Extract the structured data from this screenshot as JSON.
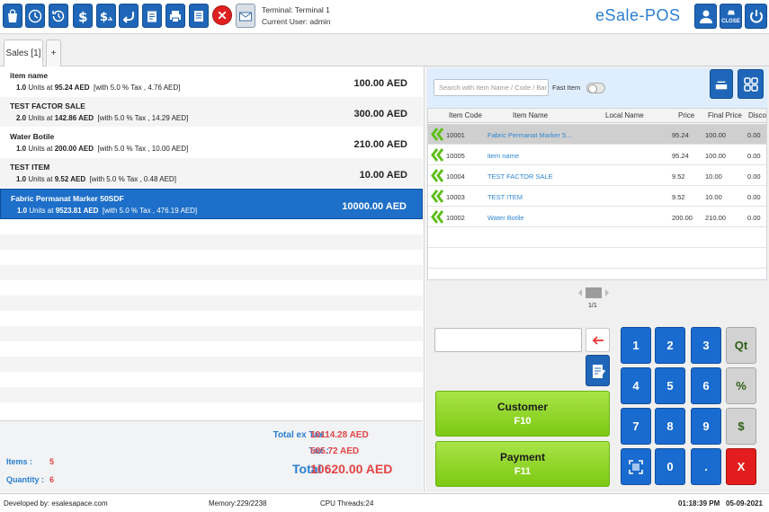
{
  "terminal": {
    "terminal_label": "Terminal: Terminal 1",
    "user_label": "Current User: admin"
  },
  "brand": "eSale-POS",
  "toolbar_icons": [
    "bag-icon",
    "clock-icon",
    "history-icon",
    "dollar-icon",
    "dollar-return-icon",
    "undo-icon",
    "clipboard-icon",
    "printer-icon",
    "report-icon",
    "cancel-icon",
    "mail-icon"
  ],
  "right_icons": {
    "user": "user-icon",
    "close_label": "CLOSE",
    "power": "power-icon"
  },
  "tabs": [
    {
      "label": "Sales [1]"
    },
    {
      "label": "+"
    }
  ],
  "cart": [
    {
      "name": "item name",
      "qty": "1.0",
      "units_at": "Units at",
      "price": "95.24 AED",
      "tax": "[with 5.0 % Tax , 4.76 AED]",
      "total": "100.00 AED"
    },
    {
      "name": "TEST FACTOR SALE",
      "qty": "2.0",
      "units_at": "Units at",
      "price": "142.86 AED",
      "tax": "[with 5.0 % Tax , 14.29 AED]",
      "total": "300.00 AED"
    },
    {
      "name": "Water Botile",
      "qty": "1.0",
      "units_at": "Units at",
      "price": "200.00 AED",
      "tax": "[with 5.0 % Tax , 10.00 AED]",
      "total": "210.00 AED"
    },
    {
      "name": "TEST ITEM",
      "qty": "1.0",
      "units_at": "Units at",
      "price": "9.52 AED",
      "tax": "[with 5.0 % Tax , 0.48 AED]",
      "total": "10.00 AED"
    },
    {
      "name": "Fabric Permanat Marker 50SDF",
      "qty": "1.0",
      "units_at": "Units at",
      "price": "9523.81 AED",
      "tax": "[with 5.0 % Tax , 476.19 AED]",
      "total": "10000.00 AED"
    }
  ],
  "summary": {
    "total_ex_tax_label": "Total ex Tax :",
    "total_ex_tax": "10114.28 AED",
    "tax_label": "Tax :",
    "tax": "505.72 AED",
    "total_label": "Total :",
    "total": "10620.00 AED",
    "items_label": "Items :",
    "items": "5",
    "quantity_label": "Quantity :",
    "quantity": "6"
  },
  "search": {
    "placeholder": "Search with Item Name / Code / Bar",
    "fast_item_label": "Fast Item"
  },
  "grid": {
    "columns": [
      "Item Code",
      "Item Name",
      "Local Name",
      "Price",
      "Final Price",
      "Disco"
    ],
    "rows": [
      {
        "code": "10001",
        "name": "Fabric Permanat Marker 5...",
        "local": "",
        "price": "95.24",
        "final": "100.00",
        "disc": "0.00"
      },
      {
        "code": "10005",
        "name": "item name",
        "local": "",
        "price": "95.24",
        "final": "100.00",
        "disc": "0.00"
      },
      {
        "code": "10004",
        "name": "TEST FACTOR SALE",
        "local": "",
        "price": "9.52",
        "final": "10.00",
        "disc": "0.00"
      },
      {
        "code": "10003",
        "name": "TEST ITEM",
        "local": "",
        "price": "9.52",
        "final": "10.00",
        "disc": "0.00"
      },
      {
        "code": "10002",
        "name": "Water Botile",
        "local": "",
        "price": "200.00",
        "final": "210.00",
        "disc": "0.00"
      }
    ]
  },
  "pager": {
    "page": "1/1"
  },
  "actions": {
    "customer_label": "Customer",
    "customer_key": "F10",
    "payment_label": "Payment",
    "payment_key": "F11"
  },
  "keypad": {
    "k1": "1",
    "k2": "2",
    "k3": "3",
    "qt": "Qt",
    "k4": "4",
    "k5": "5",
    "k6": "6",
    "pct": "%",
    "k7": "7",
    "k8": "8",
    "k9": "9",
    "dollar": "$",
    "k0": "0",
    "dot": ".",
    "clear": "X"
  },
  "status": {
    "developer": "Developed by: esalesapace.com",
    "memory": "Memory:229/2238",
    "threads": "CPU Threads:24",
    "time": "01:18:39 PM",
    "date": "05-09-2021"
  },
  "colors": {
    "accent": "#1f66b8",
    "brand_text": "#2a7fd0",
    "total_red": "#e24545",
    "selected_row": "#1d6fc9",
    "green_button": "#7cc913"
  }
}
